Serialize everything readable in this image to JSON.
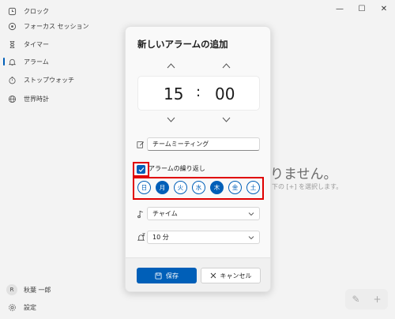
{
  "window": {
    "minimize_glyph": "—",
    "maximize_glyph": "☐",
    "close_glyph": "✕"
  },
  "sidebar": {
    "items": [
      {
        "label": "クロック",
        "icon": "clock-icon"
      },
      {
        "label": "フォーカス セッション",
        "icon": "focus-icon"
      },
      {
        "label": "タイマー",
        "icon": "hourglass-icon"
      },
      {
        "label": "アラーム",
        "icon": "bell-icon",
        "active": true
      },
      {
        "label": "ストップウォッチ",
        "icon": "stopwatch-icon"
      },
      {
        "label": "世界時計",
        "icon": "globe-icon"
      }
    ],
    "user": {
      "initial": "R",
      "name": "秋葉 一郎"
    },
    "settings_label": "設定"
  },
  "background": {
    "empty_title": "りません。",
    "empty_sub": "下の [+] を選択します。",
    "fab_edit": "✎",
    "fab_add": "+"
  },
  "dialog": {
    "title": "新しいアラームの追加",
    "hour": "15",
    "separator": ":",
    "minute": "00",
    "alarm_name": "チームミーティング",
    "repeat_label": "アラームの繰り返し",
    "repeat_checked": true,
    "days": [
      {
        "label": "日",
        "on": false
      },
      {
        "label": "月",
        "on": true
      },
      {
        "label": "火",
        "on": false
      },
      {
        "label": "水",
        "on": false
      },
      {
        "label": "木",
        "on": true
      },
      {
        "label": "金",
        "on": false
      },
      {
        "label": "土",
        "on": false
      }
    ],
    "sound": "チャイム",
    "snooze": "10 分",
    "save_label": "保存",
    "cancel_label": "キャンセル"
  },
  "colors": {
    "accent": "#005fb8",
    "highlight": "#e00000"
  }
}
